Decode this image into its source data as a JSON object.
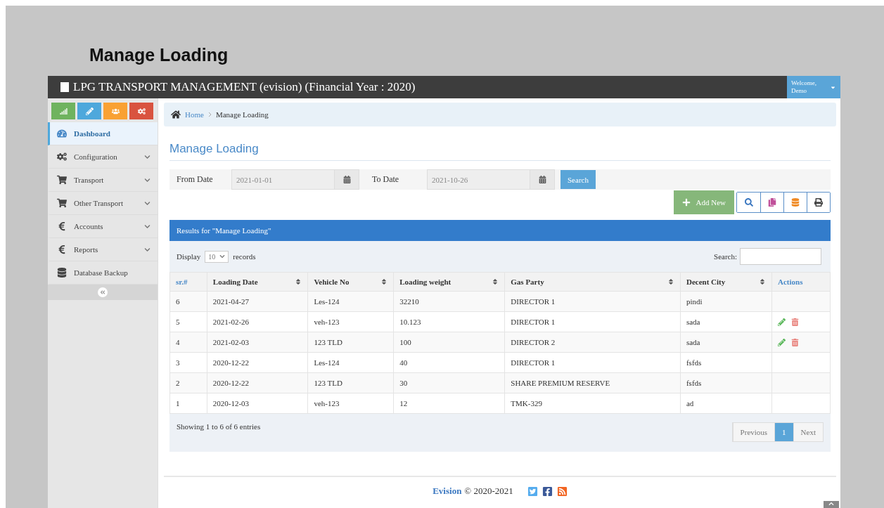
{
  "page_title": "Manage Loading",
  "topbar": {
    "title": "LPG TRANSPORT MANAGEMENT (evision) (Financial Year : 2020)",
    "user": "Welcome, Demo"
  },
  "sidebar": {
    "shortcuts": [
      {
        "kind": "chart",
        "color": "#6fb35f"
      },
      {
        "kind": "pencil",
        "color": "#4ea8dc"
      },
      {
        "kind": "users",
        "color": "#f9a133"
      },
      {
        "kind": "gears",
        "color": "#d9533f"
      }
    ],
    "items": [
      {
        "label": "Dashboard",
        "selected": true,
        "expandable": false
      },
      {
        "label": "Configuration",
        "selected": false,
        "expandable": true
      },
      {
        "label": "Transport",
        "selected": false,
        "expandable": true
      },
      {
        "label": "Other Transport",
        "selected": false,
        "expandable": true
      },
      {
        "label": "Accounts",
        "selected": false,
        "expandable": true
      },
      {
        "label": "Reports",
        "selected": false,
        "expandable": true
      },
      {
        "label": "Database Backup",
        "selected": false,
        "expandable": false
      }
    ]
  },
  "breadcrumb": [
    {
      "label": "Home",
      "link": true
    },
    {
      "label": "Manage Loading",
      "link": false
    }
  ],
  "heading": "Manage Loading",
  "filter": {
    "from_label": "From Date",
    "from_value": "2021-01-01",
    "to_label": "To Date",
    "to_value": "2021-10-26",
    "button": "Search"
  },
  "toolbar": {
    "add_button": "Add New",
    "tools": [
      {
        "kind": "search"
      },
      {
        "kind": "copy"
      },
      {
        "kind": "database"
      },
      {
        "kind": "print"
      }
    ]
  },
  "panel": {
    "title": "Results for \"Manage Loading\"",
    "display_label": "Display",
    "page_size": "10",
    "records_label": "records",
    "search_label": "Search:",
    "columns": [
      {
        "label": "sr.#",
        "sortable": false,
        "link": true
      },
      {
        "label": "Loading Date",
        "sortable": true,
        "link": false
      },
      {
        "label": "Vehicle No",
        "sortable": true,
        "link": false
      },
      {
        "label": "Loading weight",
        "sortable": true,
        "link": false
      },
      {
        "label": "Gas Party",
        "sortable": true,
        "link": false
      },
      {
        "label": "Decent City",
        "sortable": true,
        "link": false
      },
      {
        "label": "Actions",
        "sortable": false,
        "link": true
      }
    ],
    "rows": [
      {
        "cells": [
          "6",
          "2021-04-27",
          "Les-124",
          "32210",
          "DIRECTOR 1",
          "pindi"
        ],
        "actions": false
      },
      {
        "cells": [
          "5",
          "2021-02-26",
          "veh-123",
          "10.123",
          "DIRECTOR 1",
          "sada"
        ],
        "actions": true
      },
      {
        "cells": [
          "4",
          "2021-02-03",
          "123 TLD",
          "100",
          "DIRECTOR 2",
          "sada"
        ],
        "actions": true
      },
      {
        "cells": [
          "3",
          "2020-12-22",
          "Les-124",
          "40",
          "DIRECTOR 1",
          "fsfds"
        ],
        "actions": false
      },
      {
        "cells": [
          "2",
          "2020-12-22",
          "123 TLD",
          "30",
          "SHARE PREMIUM RESERVE",
          "fsfds"
        ],
        "actions": false
      },
      {
        "cells": [
          "1",
          "2020-12-03",
          "veh-123",
          "12",
          "TMK-329",
          "ad"
        ],
        "actions": false
      }
    ],
    "info": "Showing 1 to 6 of 6 entries",
    "pagination": [
      {
        "label": "Previous",
        "selected": false
      },
      {
        "label": "1",
        "selected": true
      },
      {
        "label": "Next",
        "selected": false
      }
    ]
  },
  "footer": {
    "brand": "Evision",
    "copyright": "© 2020-2021"
  }
}
